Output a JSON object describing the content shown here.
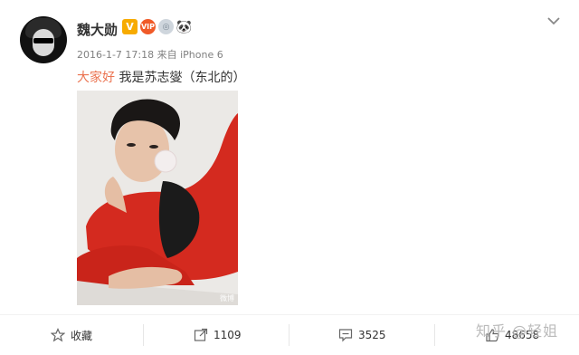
{
  "post": {
    "author": "魏大勋",
    "meta": "2016-1-7 17:18 来自 iPhone 6",
    "topic": "大家好",
    "text": " 我是苏志燮（东北的）",
    "photo_watermark": "微博"
  },
  "badges": {
    "verified": "V",
    "vip": "VIP",
    "medal": "◎",
    "panda": "🐼"
  },
  "actions": {
    "favorite_label": "收藏",
    "repost_count": "1109",
    "comment_count": "3525",
    "like_count": "48658"
  },
  "watermark": "知乎 @轻姐",
  "colors": {
    "topic": "#eb7350",
    "verified_badge": "#f7ab00",
    "jacket_red": "#d42a1f"
  }
}
